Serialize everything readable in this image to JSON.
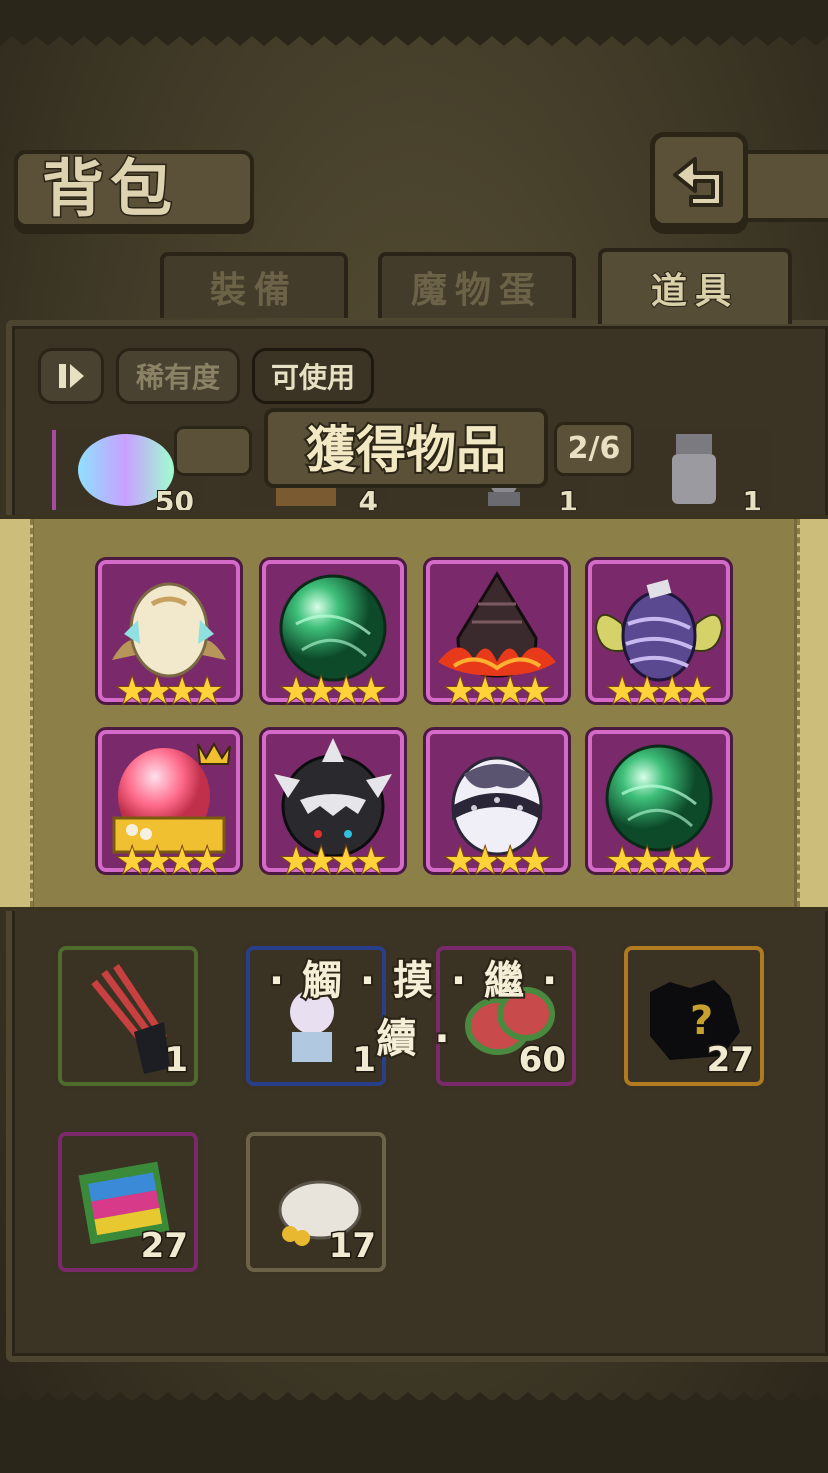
{
  "header": {
    "title": "背包",
    "back_icon": "return-arrow-icon"
  },
  "tabs": [
    {
      "label": "裝備",
      "active": false
    },
    {
      "label": "魔物蛋",
      "active": false
    },
    {
      "label": "道具",
      "active": true
    }
  ],
  "filters": {
    "toggle_icon": "sort-toggle-icon",
    "rarity_label": "稀有度",
    "usable_label": "可使用"
  },
  "inventory_strip": [
    {
      "name": "rainbow-crystal",
      "count": "50"
    },
    {
      "name": "chest-item",
      "count": "4"
    },
    {
      "name": "statue-figure",
      "count": "1"
    },
    {
      "name": "armored-figure",
      "count": "1"
    }
  ],
  "popup": {
    "title": "獲得物品",
    "page": "2/6",
    "rewards": [
      {
        "name": "winged-white-egg",
        "stars": 4
      },
      {
        "name": "green-orb",
        "stars": 4
      },
      {
        "name": "flame-dark-egg",
        "stars": 4
      },
      {
        "name": "butterfly-purple-egg",
        "stars": 4
      },
      {
        "name": "crowned-pink-egg",
        "stars": 4
      },
      {
        "name": "spiked-black-egg",
        "stars": 4
      },
      {
        "name": "ringed-white-egg",
        "stars": 4
      },
      {
        "name": "green-orb",
        "stars": 4
      }
    ]
  },
  "touch_continue": "· 觸 · 摸 · 繼 · 續 ·",
  "inventory": [
    {
      "name": "flag-bundle",
      "count": "1",
      "frame": "#4f6a2e"
    },
    {
      "name": "character-figure",
      "count": "1",
      "frame": "#2a3f8a"
    },
    {
      "name": "meat-slices",
      "count": "60",
      "frame": "#7a2a6a"
    },
    {
      "name": "mystery-silhouette",
      "count": "27",
      "frame": "#b07a20"
    },
    {
      "name": "color-block-book",
      "count": "27",
      "frame": "#7a2a6a"
    },
    {
      "name": "coin-sack",
      "count": "17",
      "frame": "#6b6248"
    }
  ],
  "star_char": "★"
}
